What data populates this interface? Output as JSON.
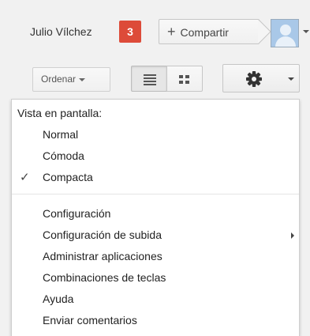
{
  "topbar": {
    "user_name": "Julio Vílchez",
    "notification_count": "3",
    "share_label": "Compartir",
    "share_plus": "+",
    "avatar_icon": "person-avatar-icon"
  },
  "toolbar": {
    "sort_label": "Ordenar",
    "view_list_icon": "list-view-icon",
    "view_grid_icon": "grid-view-icon",
    "settings_icon": "gear-icon",
    "active_view": "list"
  },
  "menu": {
    "heading": "Vista en pantalla:",
    "density_options": [
      {
        "label": "Normal",
        "checked": false
      },
      {
        "label": "Cómoda",
        "checked": false
      },
      {
        "label": "Compacta",
        "checked": true
      }
    ],
    "check_mark": "✓",
    "items": [
      {
        "label": "Configuración",
        "has_submenu": false
      },
      {
        "label": "Configuración de subida",
        "has_submenu": true
      },
      {
        "label": "Administrar aplicaciones",
        "has_submenu": false
      },
      {
        "label": "Combinaciones de teclas",
        "has_submenu": false
      },
      {
        "label": "Ayuda",
        "has_submenu": false
      },
      {
        "label": "Enviar comentarios",
        "has_submenu": false
      }
    ]
  },
  "colors": {
    "notification_bg": "#dd4b39",
    "page_bg": "#f1f1f1",
    "menu_bg": "#ffffff"
  }
}
